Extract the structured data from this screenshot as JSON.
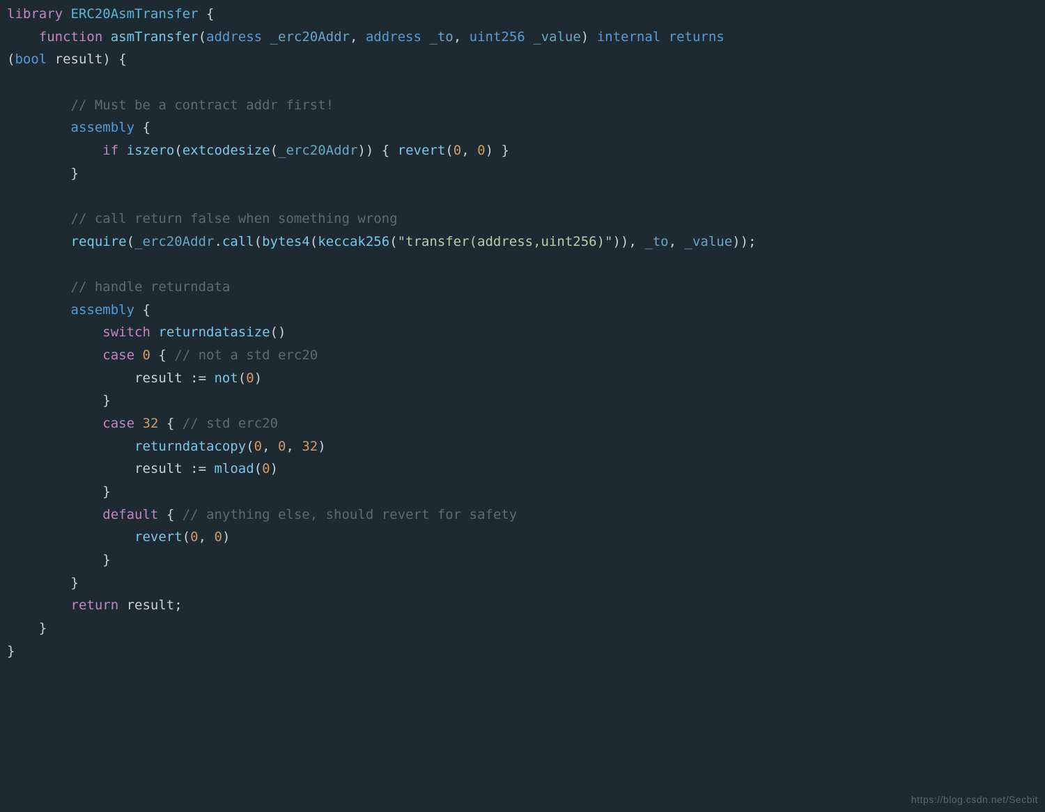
{
  "lines": {
    "l1_library": "library",
    "l1_name": "ERC20AsmTransfer",
    "l1_brace": "{",
    "l2_function": "function",
    "l2_fname": "asmTransfer",
    "l2_open": "(",
    "l2_t_addr1": "address",
    "l2_p1": "_erc20Addr",
    "l2_c1": ",",
    "l2_t_addr2": "address",
    "l2_p2": "_to",
    "l2_c2": ",",
    "l2_t_uint": "uint256",
    "l2_p3": "_value",
    "l2_close": ")",
    "l2_internal": "internal",
    "l2_returns": "returns",
    "l3_open": "(",
    "l3_bool": "bool",
    "l3_result": "result",
    "l3_close": ")",
    "l3_brace": "{",
    "c1": "// Must be a contract addr first!",
    "asm1_kw": "assembly",
    "asm1_brace": "{",
    "if_kw": "if",
    "iszero": "iszero",
    "extcodesize": "extcodesize",
    "erc20Addr_a": "_erc20Addr",
    "revert1": "revert",
    "zero_a": "0",
    "zero_b": "0",
    "brace_close_a": "}",
    "c2": "// call return false when something wrong",
    "require": "require",
    "erc20Addr_b": "_erc20Addr",
    "call": "call",
    "bytes4": "bytes4",
    "keccak": "keccak256",
    "strlit": "\"transfer(address,uint256)\"",
    "to": "_to",
    "value": "_value",
    "c3": "// handle returndata",
    "asm2_kw": "assembly",
    "asm2_brace": "{",
    "switch": "switch",
    "returndatasize": "returndatasize",
    "case1_kw": "case",
    "case1_num": "0",
    "case1_brace": "{",
    "case1_cmt": "// not a std erc20",
    "result1": "result",
    "assign1": ":=",
    "not": "not",
    "not_arg": "0",
    "case1_close": "}",
    "case2_kw": "case",
    "case2_num": "32",
    "case2_brace": "{",
    "case2_cmt": "// std erc20",
    "returndatacopy": "returndatacopy",
    "rdc_a": "0",
    "rdc_b": "0",
    "rdc_c": "32",
    "result2": "result",
    "assign2": ":=",
    "mload": "mload",
    "mload_arg": "0",
    "case2_close": "}",
    "default_kw": "default",
    "default_brace": "{",
    "default_cmt": "// anything else, should revert for safety",
    "revert2": "revert",
    "rev_a": "0",
    "rev_b": "0",
    "default_close": "}",
    "asm2_close": "}",
    "return_kw": "return",
    "return_var": "result",
    "fn_close": "}",
    "lib_close": "}"
  },
  "watermark": "https://blog.csdn.net/Secbit"
}
